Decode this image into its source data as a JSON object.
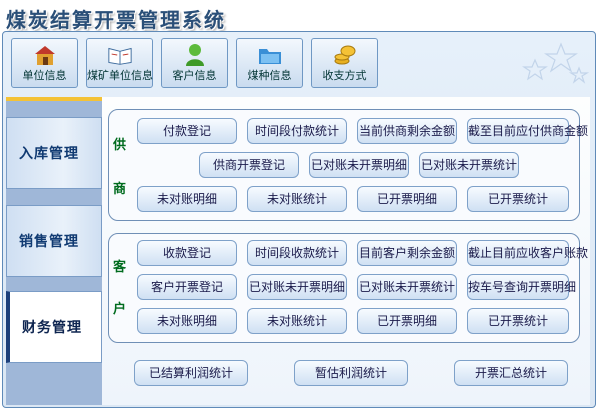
{
  "app": {
    "title": "煤炭结算开票管理系统"
  },
  "toolbar": {
    "items": [
      {
        "label": "单位信息",
        "icon": "house-icon"
      },
      {
        "label": "煤矿单位信息",
        "icon": "book-icon"
      },
      {
        "label": "客户信息",
        "icon": "person-icon"
      },
      {
        "label": "煤种信息",
        "icon": "folder-icon"
      },
      {
        "label": "收支方式",
        "icon": "coins-icon"
      }
    ]
  },
  "nav": {
    "tabs": [
      {
        "label": "入库管理",
        "active": false
      },
      {
        "label": "销售管理",
        "active": false
      },
      {
        "label": "财务管理",
        "active": true
      }
    ]
  },
  "supplier": {
    "title_top": "供",
    "title_bottom": "商",
    "row1": [
      "付款登记",
      "时间段付款统计",
      "当前供商剩余金额",
      "截至目前应付供商金额"
    ],
    "row2": [
      "供商开票登记",
      "已对账未开票明细",
      "已对账未开票统计"
    ],
    "row3": [
      "未对账明细",
      "未对账统计",
      "已开票明细",
      "已开票统计"
    ]
  },
  "customer": {
    "title_top": "客",
    "title_bottom": "户",
    "row1": [
      "收款登记",
      "时间段收款统计",
      "目前客户剩余金额",
      "截止目前应收客户账款"
    ],
    "row2": [
      "客户开票登记",
      "已对账未开票明细",
      "已对账未开票统计",
      "按车号查询开票明细"
    ],
    "row3": [
      "未对账明细",
      "未对账统计",
      "已开票明细",
      "已开票统计"
    ]
  },
  "bottom": [
    "已结算利润统计",
    "暂估利润统计",
    "开票汇总统计"
  ],
  "colors": {
    "accent": "#2a4f78",
    "group_title": "#006b1e",
    "nav_active_bar": "#1c3f7a",
    "highlight": "#f4c236"
  }
}
